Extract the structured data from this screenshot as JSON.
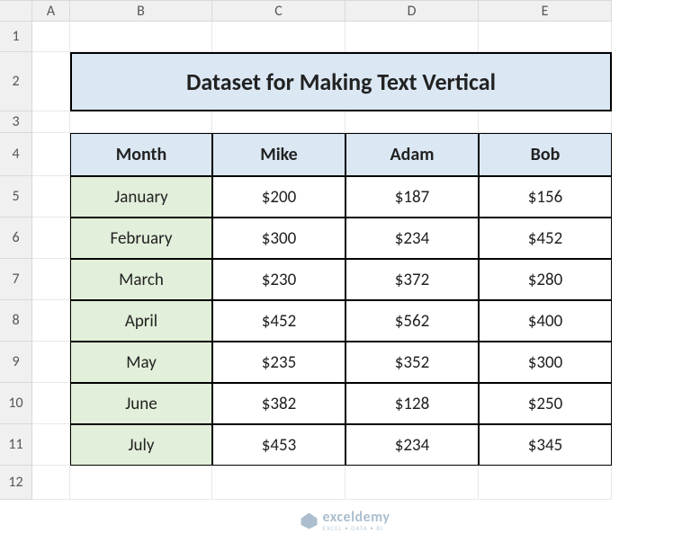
{
  "columns": [
    "A",
    "B",
    "C",
    "D",
    "E"
  ],
  "rows": [
    "1",
    "2",
    "3",
    "4",
    "5",
    "6",
    "7",
    "8",
    "9",
    "10",
    "11",
    "12"
  ],
  "title": "Dataset for Making Text Vertical",
  "headers": {
    "month": "Month",
    "c1": "Mike",
    "c2": "Adam",
    "c3": "Bob"
  },
  "data": [
    {
      "month": "January",
      "c1": "$200",
      "c2": "$187",
      "c3": "$156"
    },
    {
      "month": "February",
      "c1": "$300",
      "c2": "$234",
      "c3": "$452"
    },
    {
      "month": "March",
      "c1": "$230",
      "c2": "$372",
      "c3": "$280"
    },
    {
      "month": "April",
      "c1": "$452",
      "c2": "$562",
      "c3": "$400"
    },
    {
      "month": "May",
      "c1": "$235",
      "c2": "$352",
      "c3": "$300"
    },
    {
      "month": "June",
      "c1": "$382",
      "c2": "$128",
      "c3": "$250"
    },
    {
      "month": "July",
      "c1": "$453",
      "c2": "$234",
      "c3": "$345"
    }
  ],
  "watermark": {
    "brand": "exceldemy",
    "tagline": "EXCEL • DATA • BI"
  }
}
